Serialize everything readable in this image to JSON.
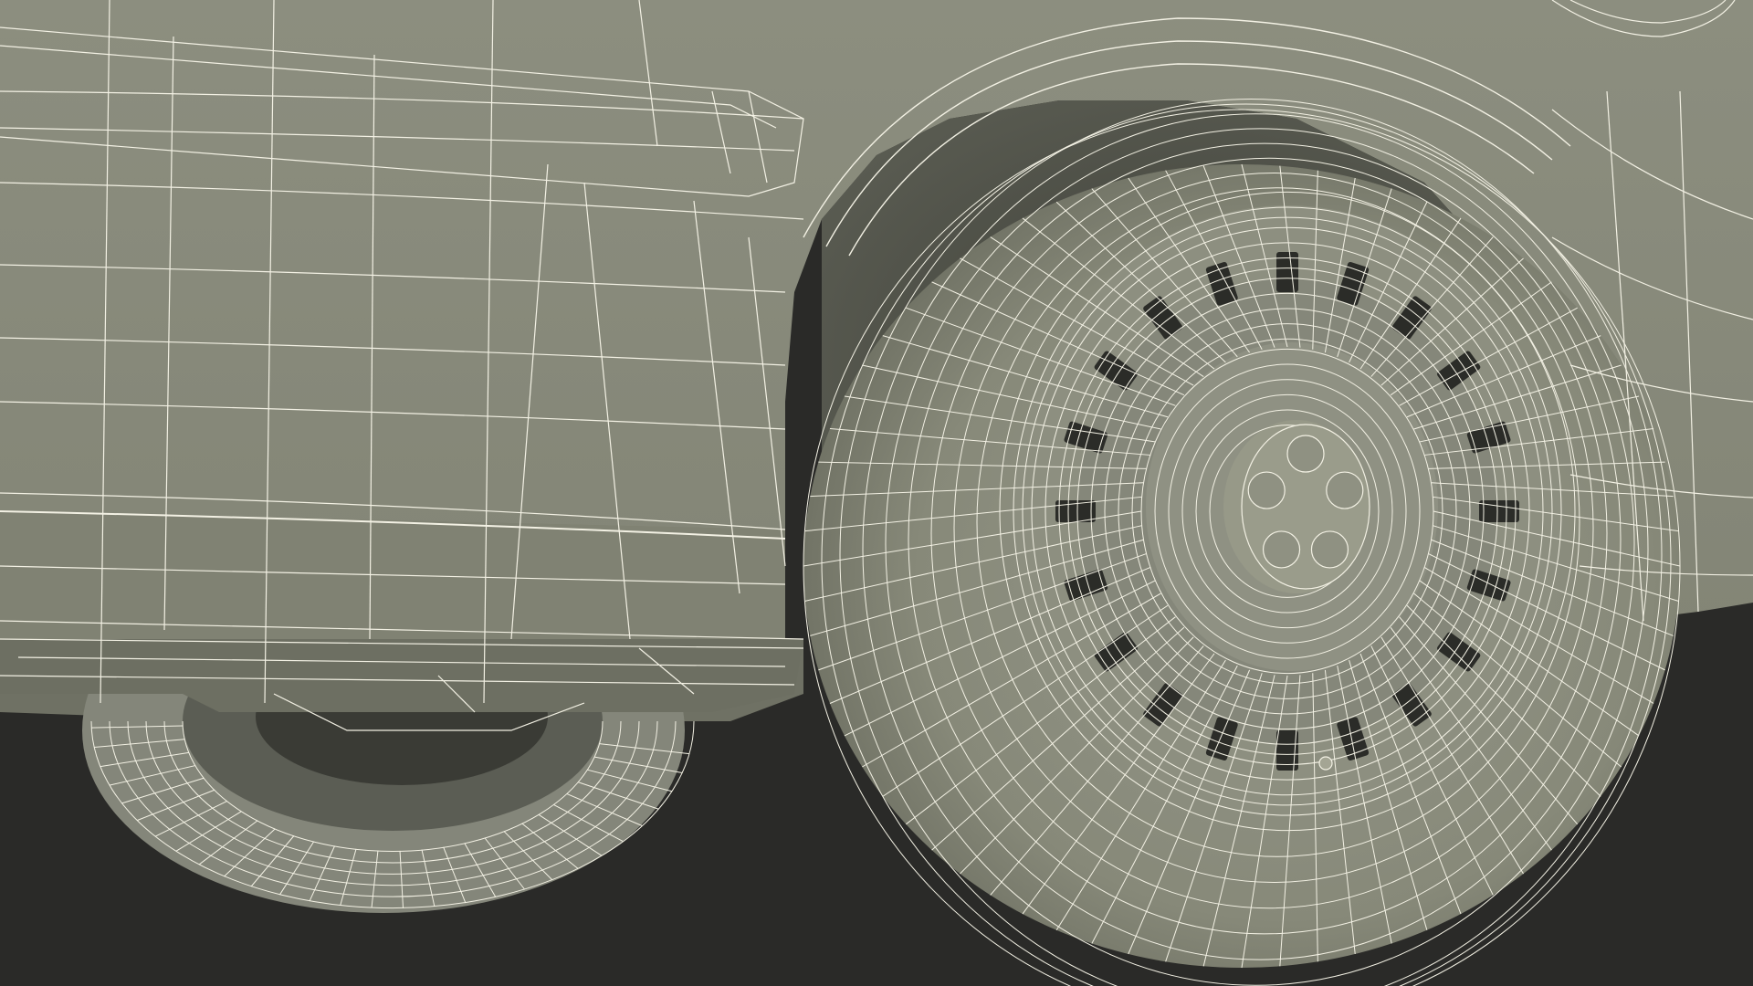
{
  "scene": {
    "subject": "wireframe-car-wheel-render",
    "colors": {
      "background": "#2a2a28",
      "body": "#87897a",
      "body_light": "#959786",
      "body_dark": "#6f7163",
      "shadow": "#4e5047",
      "tire": "#8a8c7d",
      "tire_dark": "#6c6e61",
      "wire": "#f3f1e4",
      "slot": "#2b2c28"
    }
  }
}
